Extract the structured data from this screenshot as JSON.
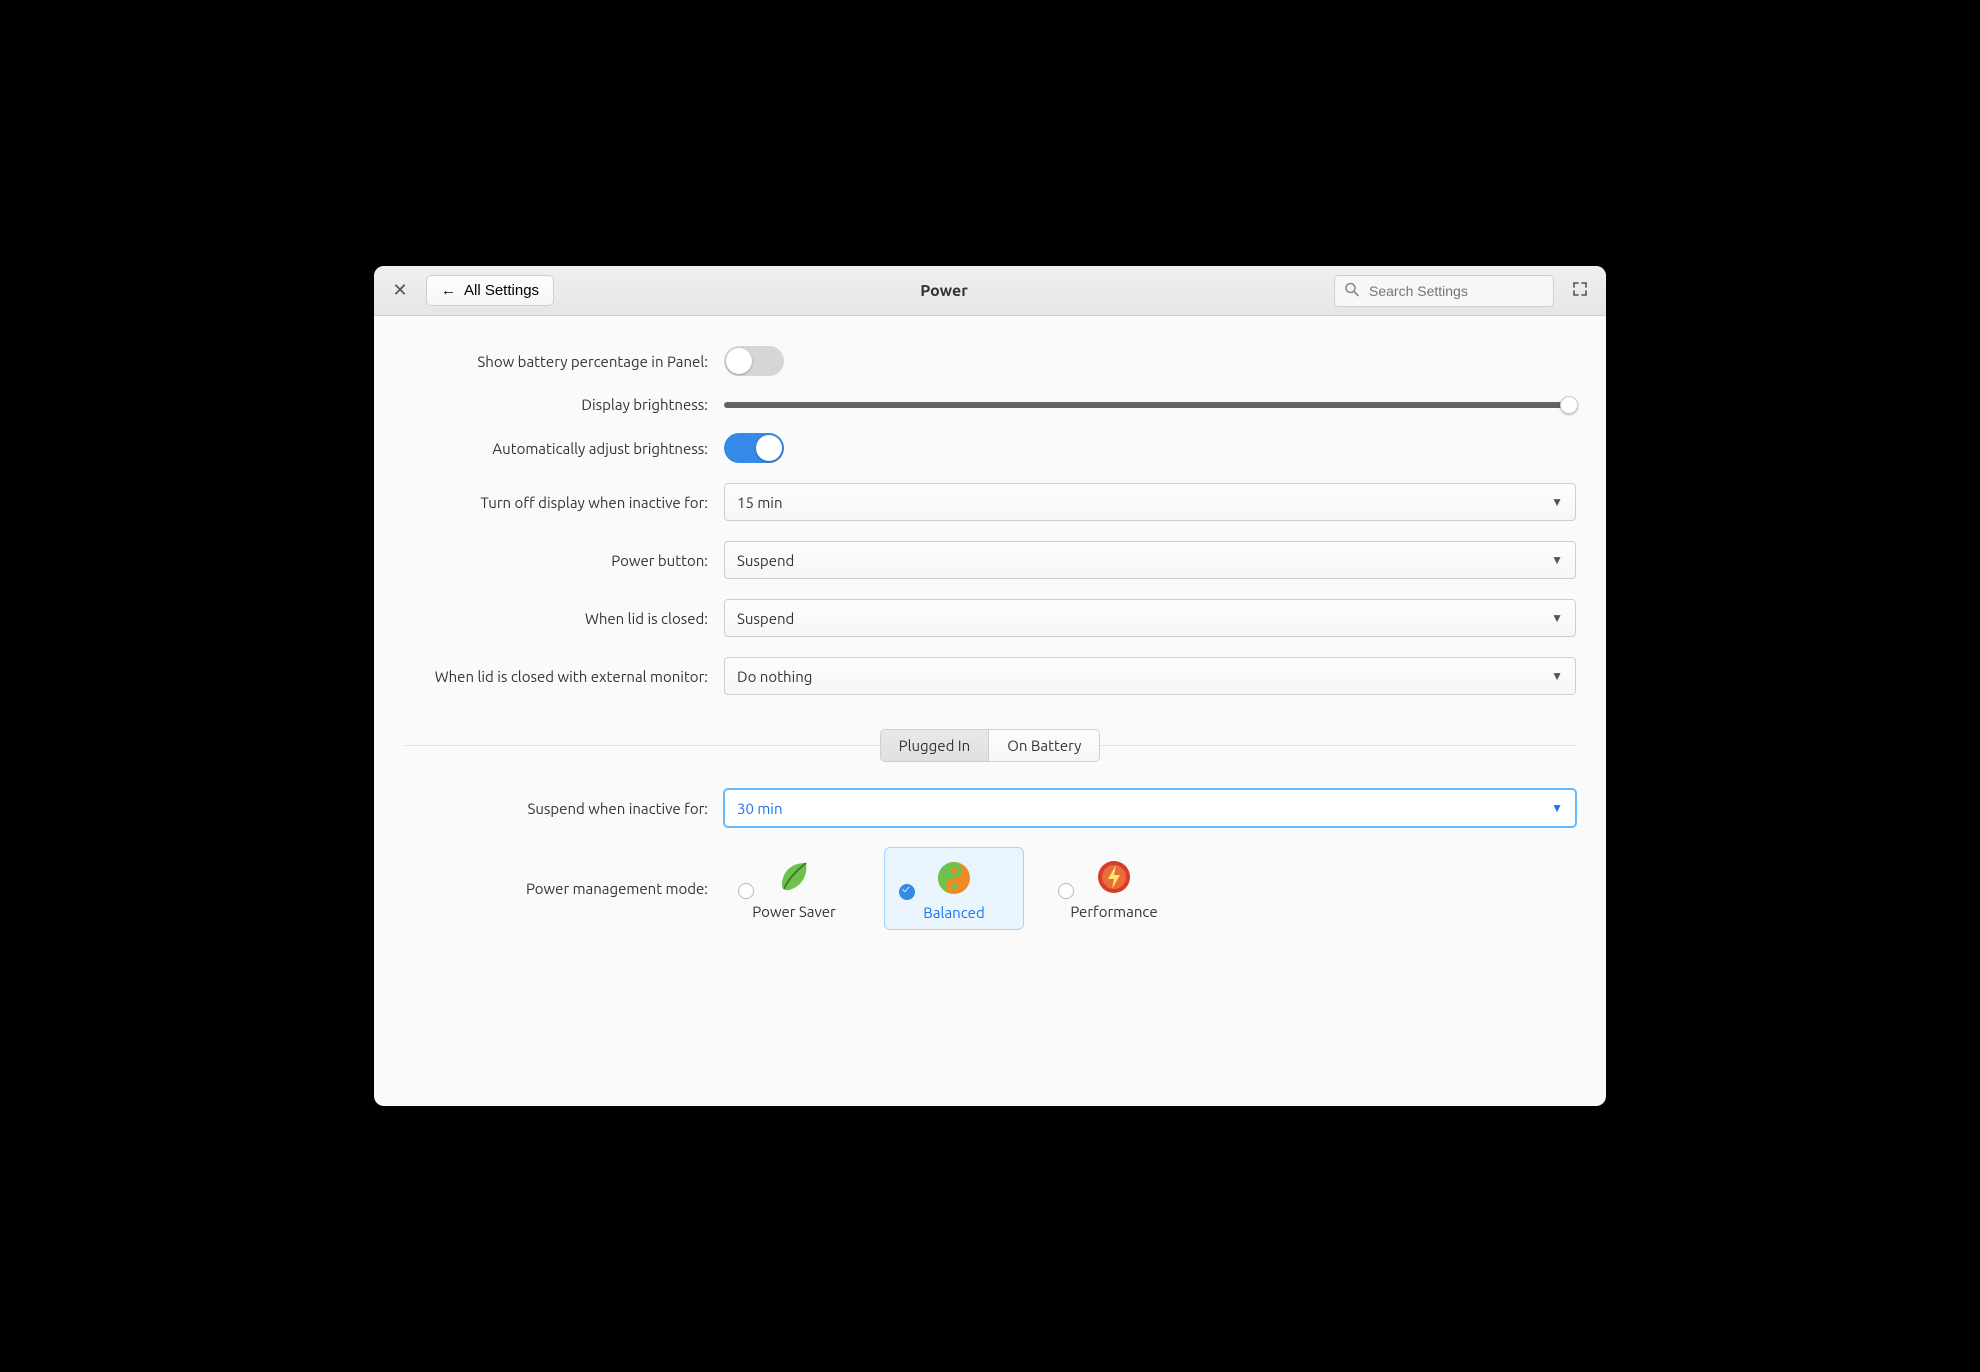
{
  "header": {
    "back_label": "All Settings",
    "title": "Power",
    "search_placeholder": "Search Settings"
  },
  "settings": {
    "battery_pct_label": "Show battery percentage in Panel:",
    "brightness_label": "Display brightness:",
    "auto_brightness_label": "Automatically adjust brightness:",
    "display_off_label": "Turn off display when inactive for:",
    "display_off_value": "15 min",
    "power_button_label": "Power button:",
    "power_button_value": "Suspend",
    "lid_closed_label": "When lid is closed:",
    "lid_closed_value": "Suspend",
    "lid_ext_label": "When lid is closed with external monitor:",
    "lid_ext_value": "Do nothing"
  },
  "tabs": {
    "plugged": "Plugged In",
    "battery": "On Battery"
  },
  "plan": {
    "suspend_label": "Suspend when inactive for:",
    "suspend_value": "30 min",
    "mode_label": "Power management mode:",
    "modes": {
      "saver": "Power Saver",
      "balanced": "Balanced",
      "performance": "Performance"
    }
  }
}
